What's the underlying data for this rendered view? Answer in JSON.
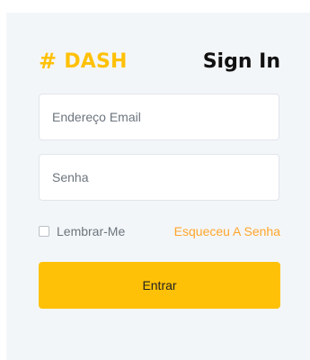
{
  "header": {
    "logo_symbol": "#",
    "logo_text": "DASH",
    "title": "Sign In"
  },
  "form": {
    "email_placeholder": "Endereço Email",
    "email_value": "",
    "password_placeholder": "Senha",
    "password_value": "",
    "remember_label": "Lembrar-Me",
    "remember_checked": false,
    "forgot_link": "Esqueceu A Senha",
    "submit_label": "Entrar"
  },
  "colors": {
    "accent": "#ffc107",
    "link": "#ffa62b",
    "card_background": "#f3f6f9",
    "text_dark": "#111111"
  },
  "icons": {
    "logo_icon": "hash-icon",
    "checkbox_icon": "checkbox-unchecked-icon"
  }
}
